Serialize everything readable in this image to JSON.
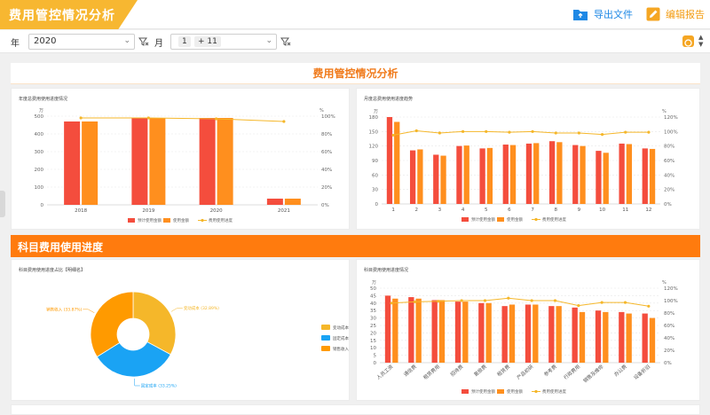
{
  "header": {
    "title": "费用管控情况分析",
    "export_label": "导出文件",
    "edit_label": "编辑报告"
  },
  "filters": {
    "year_label": "年",
    "year_value": "2020",
    "month_label": "月",
    "month_chip_1": "1",
    "month_chip_2": "+ 11"
  },
  "panel": {
    "title": "费用管控情况分析"
  },
  "section2": {
    "title": "科目费用使用进度"
  },
  "colors": {
    "red": "#f44d3d",
    "orange": "#ff8f1e",
    "yellow": "#f5b72a",
    "blue": "#1aa3f4",
    "pie_orange": "#ff9a00"
  },
  "charts": [
    {
      "id": "yearly",
      "title": "年度总费用使用进度情况",
      "type": "bar",
      "categories": [
        "2018",
        "2019",
        "2020",
        "2021"
      ],
      "series": [
        {
          "name": "预计使用金额",
          "values": [
            470,
            490,
            490,
            35
          ]
        },
        {
          "name": "使用金额",
          "values": [
            470,
            490,
            490,
            35
          ]
        },
        {
          "name": "费用使用进度",
          "values": [
            98,
            98,
            97,
            94
          ]
        }
      ],
      "y_ticks": [
        "0",
        "100",
        "200",
        "300",
        "400",
        "500"
      ],
      "y2_ticks": [
        "0%",
        "20%",
        "40%",
        "60%",
        "80%",
        "100%"
      ],
      "ylabel": "万",
      "y2label": "%",
      "ylim": [
        0,
        500
      ],
      "y2lim": [
        0,
        100
      ]
    },
    {
      "id": "monthly",
      "title": "月度总费用使用进度趋势",
      "type": "bar",
      "categories": [
        "1",
        "2",
        "3",
        "4",
        "5",
        "6",
        "7",
        "8",
        "9",
        "10",
        "11",
        "12"
      ],
      "series": [
        {
          "name": "预计使用金额",
          "values": [
            180,
            111,
            102,
            120,
            115,
            123,
            125,
            130,
            122,
            110,
            125,
            115
          ]
        },
        {
          "name": "使用金额",
          "values": [
            170,
            113,
            100,
            121,
            116,
            122,
            126,
            128,
            120,
            106,
            124,
            114
          ]
        },
        {
          "name": "费用使用进度",
          "values": [
            95,
            101,
            98,
            100,
            100,
            99,
            100,
            98,
            98,
            96,
            99,
            99
          ]
        }
      ],
      "y_ticks": [
        "0",
        "30",
        "60",
        "90",
        "120",
        "150",
        "180"
      ],
      "y2_ticks": [
        "0%",
        "20%",
        "40%",
        "60%",
        "80%",
        "100%",
        "120%"
      ],
      "ylabel": "万",
      "y2label": "%",
      "ylim": [
        0,
        180
      ],
      "y2lim": [
        0,
        120
      ]
    },
    {
      "id": "pie",
      "title": "科目费用使用进度占比【明细名】",
      "type": "pie",
      "slices": [
        {
          "name": "变动成本",
          "label": "变动成本 (32.89%)",
          "value": 32.89
        },
        {
          "name": "固定成本",
          "label": "固定成本 (33.25%)",
          "value": 33.25
        },
        {
          "name": "销售收入",
          "label": "销售收入 (33.87%)",
          "value": 33.87
        }
      ]
    },
    {
      "id": "subjects",
      "title": "科目费用使用进度情况",
      "type": "bar",
      "categories": [
        "人员工资",
        "通信费",
        "租赁费用",
        "招待费",
        "差旅费",
        "租赁费",
        "产品初研",
        "参考费",
        "行政费用",
        "销售及维修",
        "办公费",
        "设备折旧"
      ],
      "series": [
        {
          "name": "预计使用金额",
          "values": [
            45,
            44,
            42,
            41,
            40,
            38,
            39,
            38,
            37,
            35,
            34,
            33
          ]
        },
        {
          "name": "使用金额",
          "values": [
            43,
            43,
            42,
            41,
            40,
            39,
            39,
            38,
            34,
            34,
            33,
            30
          ]
        },
        {
          "name": "费用使用进度",
          "values": [
            96,
            98,
            99,
            100,
            100,
            104,
            100,
            100,
            92,
            97,
            97,
            91
          ]
        }
      ],
      "y_ticks": [
        "0",
        "5",
        "10",
        "15",
        "20",
        "25",
        "30",
        "35",
        "40",
        "45",
        "50"
      ],
      "y2_ticks": [
        "0%",
        "20%",
        "40%",
        "60%",
        "80%",
        "100%",
        "120%"
      ],
      "ylabel": "万",
      "y2label": "%",
      "ylim": [
        0,
        50
      ],
      "y2lim": [
        0,
        120
      ]
    }
  ]
}
